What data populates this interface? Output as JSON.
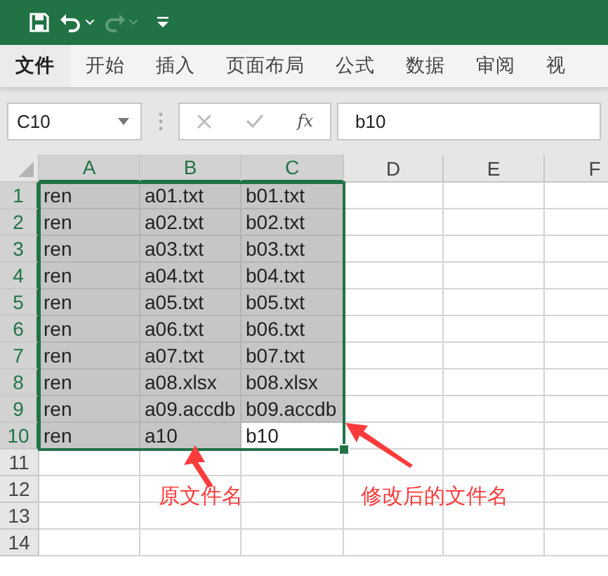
{
  "quick_access": {
    "redo_disabled": true
  },
  "ribbon_tabs": [
    {
      "label": "文件",
      "selected": true
    },
    {
      "label": "开始",
      "selected": false
    },
    {
      "label": "插入",
      "selected": false
    },
    {
      "label": "页面布局",
      "selected": false
    },
    {
      "label": "公式",
      "selected": false
    },
    {
      "label": "数据",
      "selected": false
    },
    {
      "label": "审阅",
      "selected": false
    },
    {
      "label": "视",
      "selected": false
    }
  ],
  "formula_bar": {
    "name_box": "C10",
    "function_label": "fx",
    "value": "b10"
  },
  "columns": [
    {
      "label": "A",
      "selected": true
    },
    {
      "label": "B",
      "selected": true
    },
    {
      "label": "C",
      "selected": true
    },
    {
      "label": "D",
      "selected": false
    },
    {
      "label": "E",
      "selected": false
    },
    {
      "label": "F",
      "selected": false
    }
  ],
  "rows": [
    {
      "header": "1",
      "selected": true,
      "cells": [
        {
          "text": "ren",
          "selected": true,
          "active": false
        },
        {
          "text": "a01.txt",
          "selected": true,
          "active": false
        },
        {
          "text": "b01.txt",
          "selected": true,
          "active": false
        }
      ]
    },
    {
      "header": "2",
      "selected": true,
      "cells": [
        {
          "text": "ren",
          "selected": true,
          "active": false
        },
        {
          "text": "a02.txt",
          "selected": true,
          "active": false
        },
        {
          "text": "b02.txt",
          "selected": true,
          "active": false
        }
      ]
    },
    {
      "header": "3",
      "selected": true,
      "cells": [
        {
          "text": "ren",
          "selected": true,
          "active": false
        },
        {
          "text": "a03.txt",
          "selected": true,
          "active": false
        },
        {
          "text": "b03.txt",
          "selected": true,
          "active": false
        }
      ]
    },
    {
      "header": "4",
      "selected": true,
      "cells": [
        {
          "text": "ren",
          "selected": true,
          "active": false
        },
        {
          "text": "a04.txt",
          "selected": true,
          "active": false
        },
        {
          "text": "b04.txt",
          "selected": true,
          "active": false
        }
      ]
    },
    {
      "header": "5",
      "selected": true,
      "cells": [
        {
          "text": "ren",
          "selected": true,
          "active": false
        },
        {
          "text": "a05.txt",
          "selected": true,
          "active": false
        },
        {
          "text": "b05.txt",
          "selected": true,
          "active": false
        }
      ]
    },
    {
      "header": "6",
      "selected": true,
      "cells": [
        {
          "text": "ren",
          "selected": true,
          "active": false
        },
        {
          "text": "a06.txt",
          "selected": true,
          "active": false
        },
        {
          "text": "b06.txt",
          "selected": true,
          "active": false
        }
      ]
    },
    {
      "header": "7",
      "selected": true,
      "cells": [
        {
          "text": "ren",
          "selected": true,
          "active": false
        },
        {
          "text": "a07.txt",
          "selected": true,
          "active": false
        },
        {
          "text": "b07.txt",
          "selected": true,
          "active": false
        }
      ]
    },
    {
      "header": "8",
      "selected": true,
      "cells": [
        {
          "text": "ren",
          "selected": true,
          "active": false
        },
        {
          "text": "a08.xlsx",
          "selected": true,
          "active": false
        },
        {
          "text": "b08.xlsx",
          "selected": true,
          "active": false
        }
      ]
    },
    {
      "header": "9",
      "selected": true,
      "cells": [
        {
          "text": "ren",
          "selected": true,
          "active": false
        },
        {
          "text": "a09.accdb",
          "selected": true,
          "active": false
        },
        {
          "text": "b09.accdb",
          "selected": true,
          "active": false
        }
      ]
    },
    {
      "header": "10",
      "selected": true,
      "cells": [
        {
          "text": "ren",
          "selected": true,
          "active": false
        },
        {
          "text": "a10",
          "selected": true,
          "active": false
        },
        {
          "text": "b10",
          "selected": true,
          "active": true
        }
      ]
    },
    {
      "header": "11",
      "selected": false,
      "cells": []
    },
    {
      "header": "12",
      "selected": false,
      "cells": []
    },
    {
      "header": "13",
      "selected": false,
      "cells": []
    },
    {
      "header": "14",
      "selected": false,
      "cells": []
    }
  ],
  "annotations": [
    {
      "text": "原文件名"
    },
    {
      "text": "修改后的文件名"
    }
  ]
}
